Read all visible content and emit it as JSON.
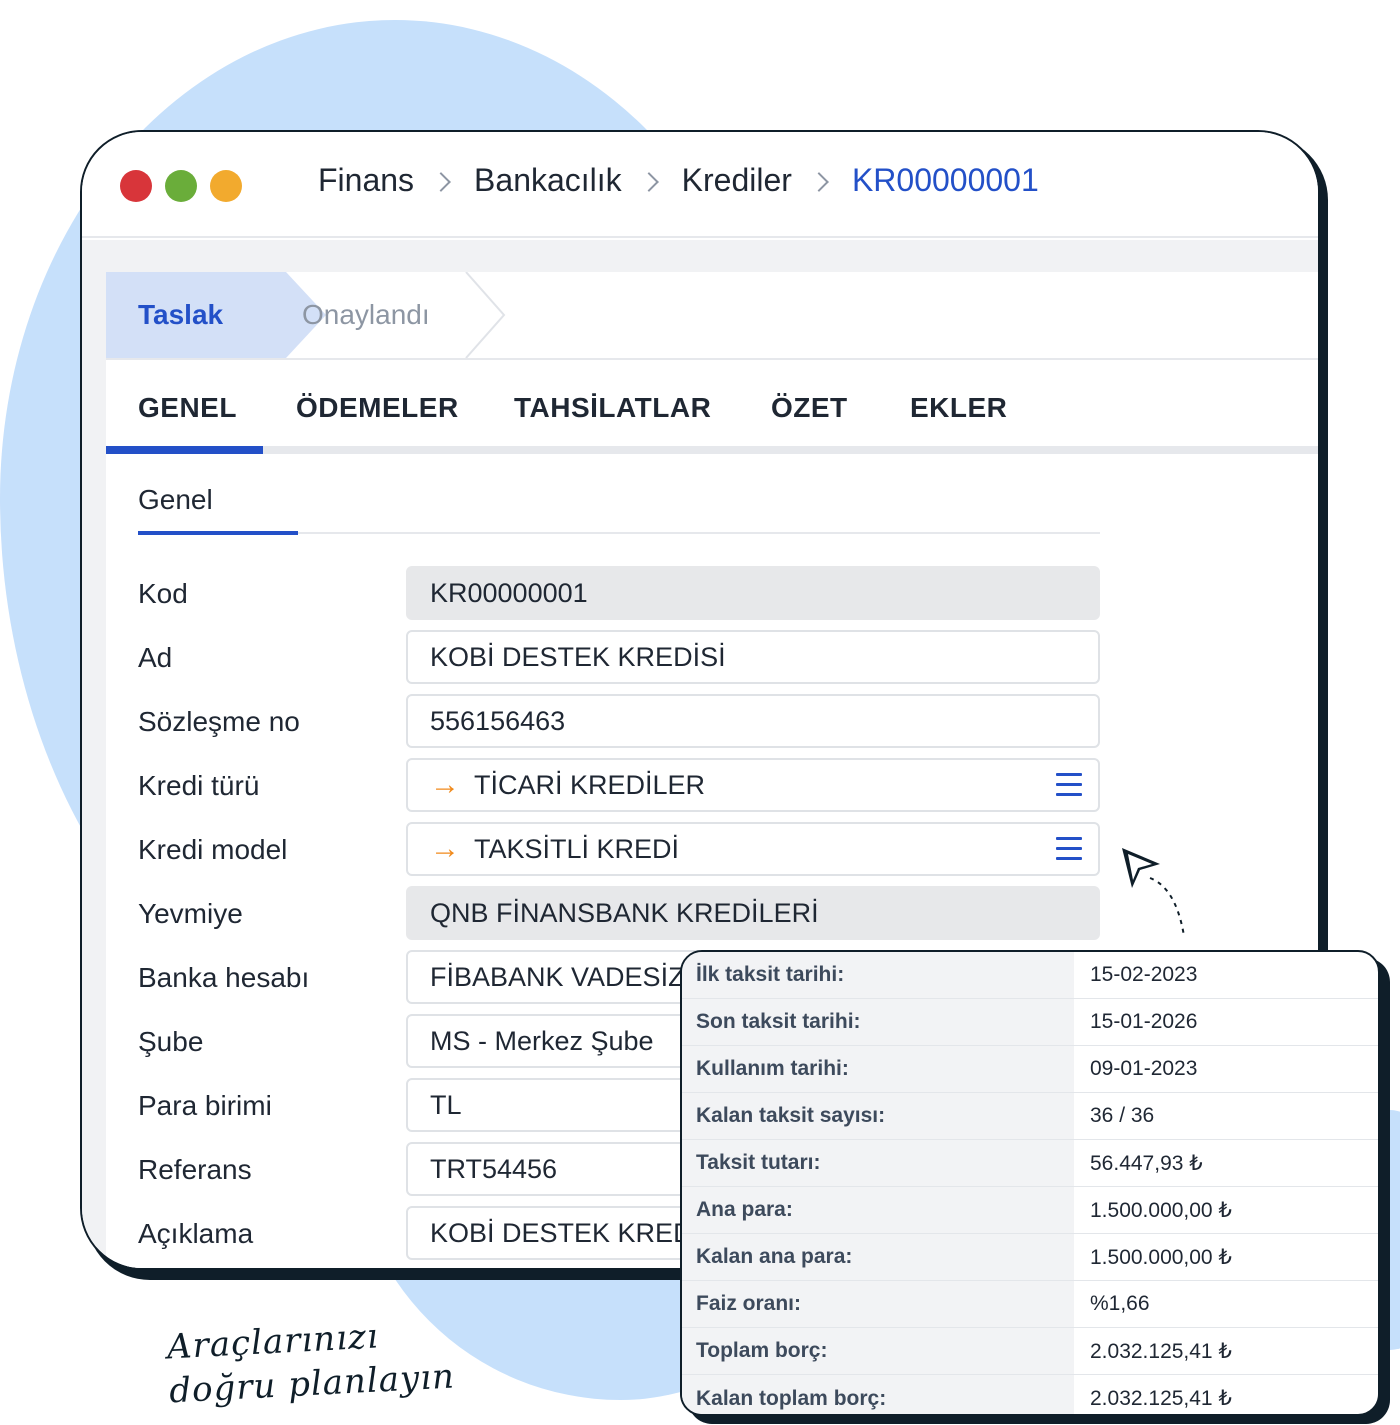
{
  "breadcrumb": {
    "items": [
      "Finans",
      "Bankacılık",
      "Krediler"
    ],
    "current": "KR00000001"
  },
  "status": {
    "active": "Taslak",
    "next": "Onaylandı"
  },
  "tabs": [
    "GENEL",
    "ÖDEMELER",
    "TAHSİLATLAR",
    "ÖZET",
    "EKLER"
  ],
  "section": {
    "title": "Genel"
  },
  "form": {
    "kod": {
      "label": "Kod",
      "value": "KR00000001"
    },
    "ad": {
      "label": "Ad",
      "value": "KOBİ DESTEK KREDİSİ"
    },
    "sozlesme": {
      "label": "Sözleşme no",
      "value": "556156463"
    },
    "kredi_turu": {
      "label": "Kredi türü",
      "value": "TİCARİ KREDİLER"
    },
    "kredi_model": {
      "label": "Kredi model",
      "value": "TAKSİTLİ KREDİ"
    },
    "yevmiye": {
      "label": "Yevmiye",
      "value": "QNB FİNANSBANK KREDİLERİ"
    },
    "banka": {
      "label": "Banka hesabı",
      "value": "FİBABANK VADESİZ"
    },
    "sube": {
      "label": "Şube",
      "value": "MS - Merkez Şube"
    },
    "para": {
      "label": "Para birimi",
      "value": "TL"
    },
    "referans": {
      "label": "Referans",
      "value": "TRT54456"
    },
    "aciklama": {
      "label": "Açıklama",
      "value": "KOBİ DESTEK KREDİ"
    }
  },
  "summary": [
    {
      "label": "İlk taksit tarihi:",
      "value": "15-02-2023"
    },
    {
      "label": "Son taksit tarihi:",
      "value": "15-01-2026"
    },
    {
      "label": "Kullanım tarihi:",
      "value": "09-01-2023"
    },
    {
      "label": "Kalan taksit sayısı:",
      "value": "36 / 36"
    },
    {
      "label": "Taksit tutarı:",
      "value": "56.447,93 ₺"
    },
    {
      "label": "Ana para:",
      "value": "1.500.000,00 ₺"
    },
    {
      "label": "Kalan ana para:",
      "value": "1.500.000,00 ₺"
    },
    {
      "label": "Faiz oranı:",
      "value": "%1,66"
    },
    {
      "label": "Toplam borç:",
      "value": "2.032.125,41 ₺"
    },
    {
      "label": "Kalan toplam borç:",
      "value": "2.032.125,41 ₺"
    }
  ],
  "slogan": {
    "line1": "Araçlarınızı",
    "line2": "doğru planlayın"
  },
  "icons": {
    "arrow": "arrow-right-icon",
    "menu": "hamburger-menu-icon",
    "cursor": "pointer-cursor-icon"
  },
  "colors": {
    "accent": "#2350c8",
    "arrow": "#f08a1c",
    "blob": "#c6e0fb",
    "dark": "#0f1e29"
  }
}
